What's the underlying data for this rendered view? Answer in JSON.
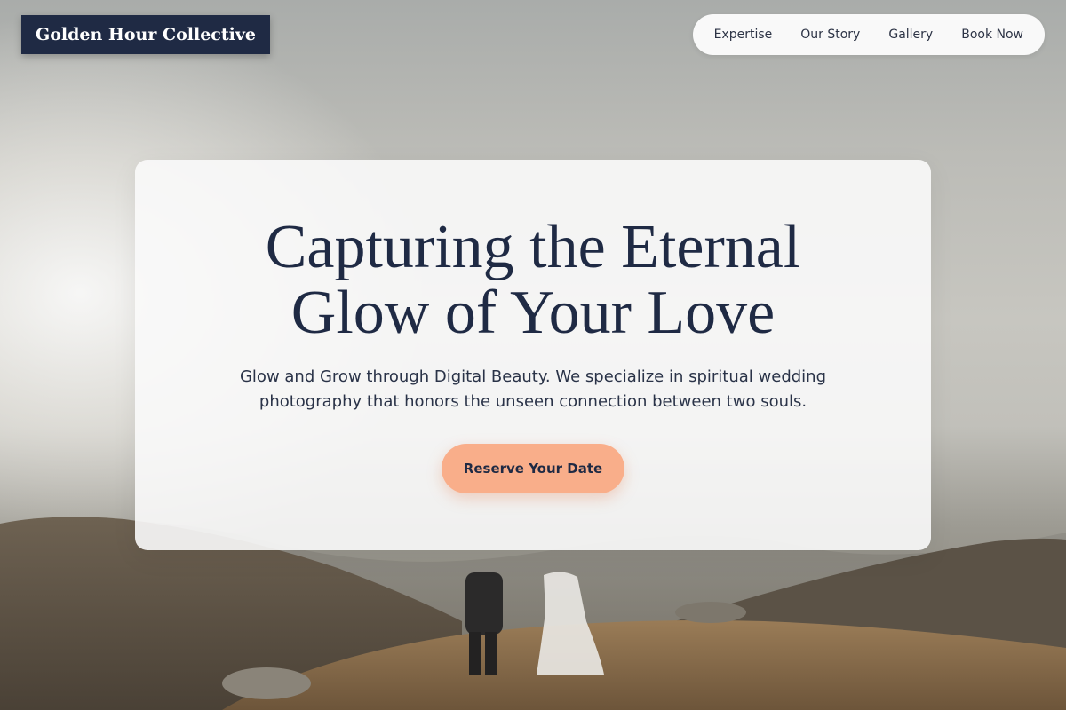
{
  "brand": {
    "name": "Golden Hour Collective"
  },
  "nav": {
    "items": [
      {
        "label": "Expertise"
      },
      {
        "label": "Our Story"
      },
      {
        "label": "Gallery"
      },
      {
        "label": "Book Now"
      }
    ]
  },
  "hero": {
    "title_lines": [
      "Capturing the Eternal",
      "Glow of Your Love"
    ],
    "subtitle_lines": [
      "Glow and Grow through Digital Beauty. We specialize in spiritual wedding",
      "photography that honors the unseen connection between two souls."
    ],
    "cta_label": "Reserve Your Date"
  },
  "colors": {
    "navy": "#1f2a44",
    "cta_peach": "#f9ae8a",
    "card_white": "#fafafa"
  }
}
